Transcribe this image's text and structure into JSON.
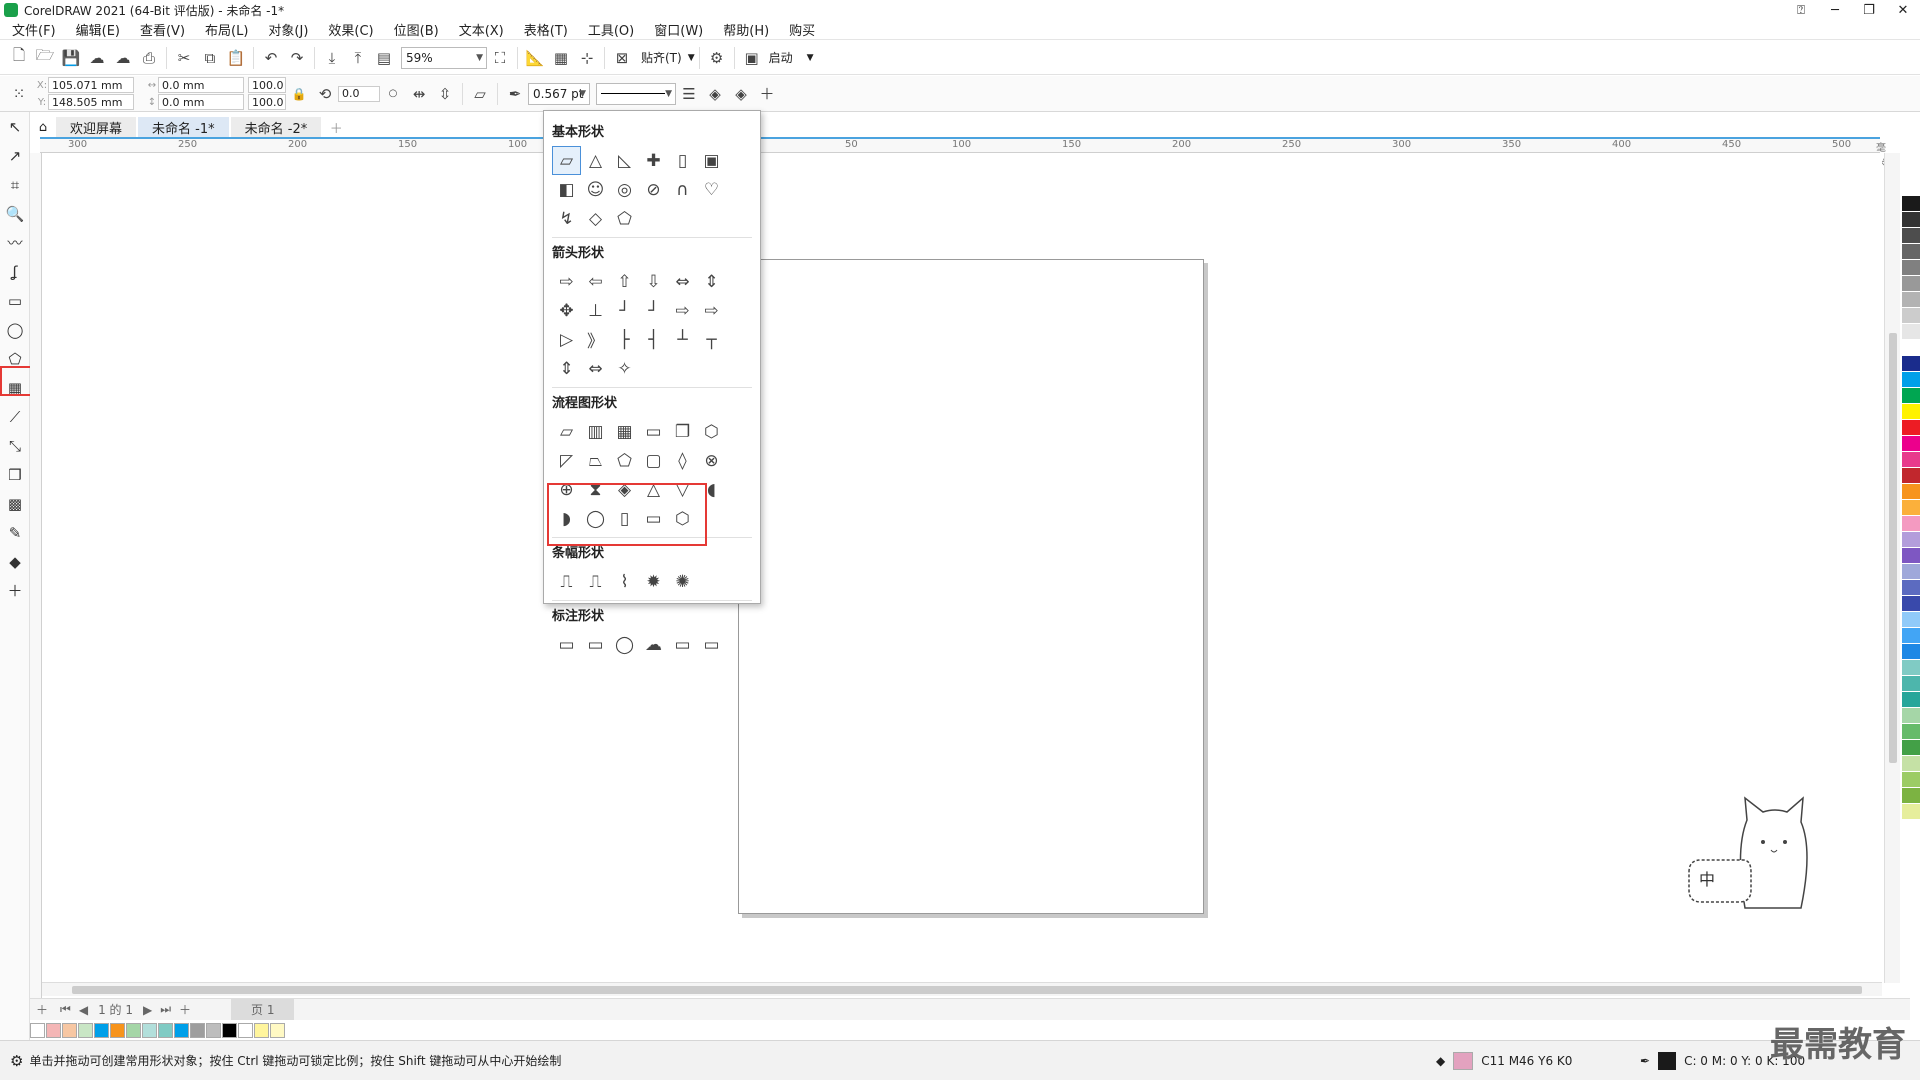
{
  "titlebar": {
    "title": "CorelDRAW 2021 (64-Bit 评估版) - 未命名 -1*"
  },
  "menu": [
    "文件(F)",
    "编辑(E)",
    "查看(V)",
    "布局(L)",
    "对象(J)",
    "效果(C)",
    "位图(B)",
    "文本(X)",
    "表格(T)",
    "工具(O)",
    "窗口(W)",
    "帮助(H)",
    "购买"
  ],
  "toolbar": {
    "zoom": "59%",
    "snap_label": "贴齐(T)",
    "launch_label": "启动"
  },
  "propbar": {
    "x": "105.071 mm",
    "y": "148.505 mm",
    "w": "0.0 mm",
    "h": "0.0 mm",
    "sx": "100.0",
    "sy": "100.0",
    "angle": "0.0",
    "outline": "0.567 pt",
    "x_label": "X:",
    "y_label": "Y:"
  },
  "tabs": {
    "welcome": "欢迎屏幕",
    "doc1": "未命名 -1*",
    "doc2": "未命名 -2*"
  },
  "ruler_labels": [
    "300",
    "250",
    "200",
    "150",
    "100",
    "50",
    "100",
    "150",
    "200",
    "250",
    "300",
    "350",
    "400",
    "450",
    "500",
    "毫米"
  ],
  "flyout": {
    "basic_title": "基本形状",
    "arrow_title": "箭头形状",
    "flow_title": "流程图形状",
    "banner_title": "条幅形状",
    "callout_title": "标注形状",
    "basic": [
      "▱",
      "△",
      "◺",
      "✚",
      "▯",
      "▣",
      "◧",
      "☺",
      "◎",
      "⊘",
      "∩",
      "♡",
      "↯",
      "◇",
      "⬠"
    ],
    "arrows": [
      "⇨",
      "⇦",
      "⇧",
      "⇩",
      "⇔",
      "⇕",
      "✥",
      "⊥",
      "┘",
      "┘",
      "⇨",
      "⇨",
      "▷",
      "》",
      "├",
      "┤",
      "┴",
      "┬",
      "⇕",
      "⇔",
      "✧"
    ],
    "flow": [
      "▱",
      "▥",
      "▦",
      "▭",
      "❐",
      "⬡",
      "◸",
      "⏢",
      "⬠",
      "▢",
      "◊",
      "⊗",
      "⊕",
      "⧗",
      "◈",
      "△",
      "▽",
      "◖",
      "◗",
      "◯",
      "▯",
      "▭",
      "⬡"
    ],
    "banners": [
      "⎍",
      "⎍",
      "⌇",
      "✹",
      "✺"
    ],
    "callouts": [
      "▭",
      "▭",
      "◯",
      "☁",
      "▭",
      "▭"
    ]
  },
  "pagenav": {
    "page_of": "1 的 1",
    "page_tab": "页 1"
  },
  "status": {
    "message": "单击并拖动可创建常用形状对象；按住 Ctrl 键拖动可锁定比例；按住 Shift 键拖动可从中心开始绘制",
    "fill": "C11 M46 Y6 K0",
    "outline": "C: 0 M: 0 Y: 0 K: 100"
  },
  "watermark": "最需教育",
  "ime_label": "中",
  "colors": {
    "fill_swatch": "#e3a2bf",
    "selected_border": "#e53935",
    "accent": "#4aa3df"
  },
  "palette": [
    "#ffffff",
    "#1a1a1a",
    "#333333",
    "#4d4d4d",
    "#666666",
    "#808080",
    "#999999",
    "#b3b3b3",
    "#cccccc",
    "#e6e6e6",
    "#ffffff",
    "#1a2c8c",
    "#00a0e9",
    "#00a651",
    "#fff200",
    "#ed1c24",
    "#ec008c",
    "#e83a8c",
    "#c1272d",
    "#f7941d",
    "#fbb03b",
    "#f49ac1",
    "#b39ddb",
    "#7e57c2",
    "#9fa8da",
    "#5c6bc0",
    "#3949ab",
    "#90caf9",
    "#42a5f5",
    "#1e88e5",
    "#80cbc4",
    "#4db6ac",
    "#26a69a",
    "#a5d6a7",
    "#66bb6a",
    "#43a047",
    "#c5e1a5",
    "#9ccc65",
    "#7cb342",
    "#e6ee9c"
  ],
  "docpal": [
    "#ffffff",
    "#f4b6b6",
    "#f7c7a3",
    "#c9e6c5",
    "#00a0e9",
    "#f7941d",
    "#a5d6a7",
    "#b2dfdb",
    "#80cbc4",
    "#00a0e9",
    "#9e9e9e",
    "#bdbdbd",
    "#000000",
    "#ffffff",
    "#fff59d",
    "#fff9c4"
  ]
}
